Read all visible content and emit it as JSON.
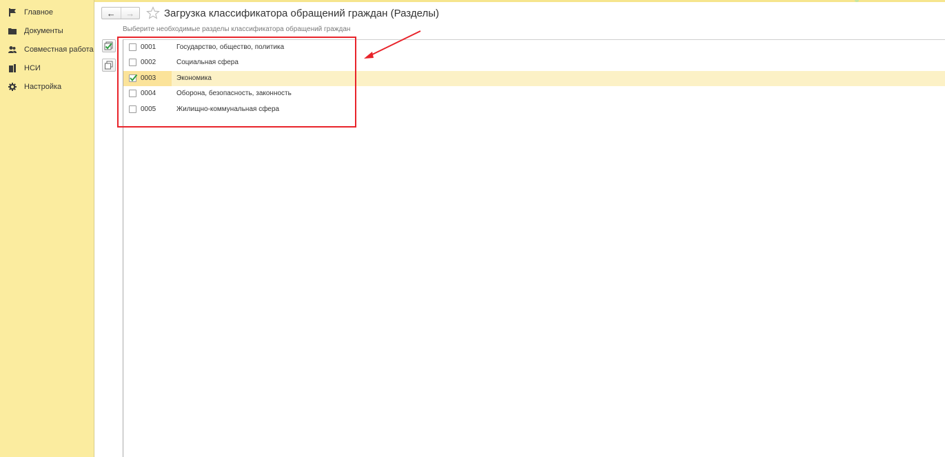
{
  "sidebar": {
    "items": [
      {
        "label": "Главное",
        "icon": "flag-icon"
      },
      {
        "label": "Документы",
        "icon": "folder-icon"
      },
      {
        "label": "Совместная работа",
        "icon": "users-icon"
      },
      {
        "label": "НСИ",
        "icon": "books-icon"
      },
      {
        "label": "Настройка",
        "icon": "gear-icon"
      }
    ]
  },
  "header": {
    "back": "←",
    "forward": "→",
    "title": "Загрузка классификатора обращений граждан (Разделы)"
  },
  "form": {
    "subtitle": "Выберите необходимые разделы классификатора обращений граждан"
  },
  "sections": [
    {
      "code": "0001",
      "name": "Государство, общество, политика",
      "checked": false
    },
    {
      "code": "0002",
      "name": "Социальная сфера",
      "checked": false
    },
    {
      "code": "0003",
      "name": "Экономика",
      "checked": true
    },
    {
      "code": "0004",
      "name": "Оборона, безопасность, законность",
      "checked": false
    },
    {
      "code": "0005",
      "name": "Жилищно-коммунальная сфера",
      "checked": false
    }
  ],
  "colors": {
    "sidebar_bg": "#fbec9f",
    "selected_row": "#fcf1c6",
    "annotation_red": "#e8232a",
    "check_green": "#2e9e3e"
  }
}
